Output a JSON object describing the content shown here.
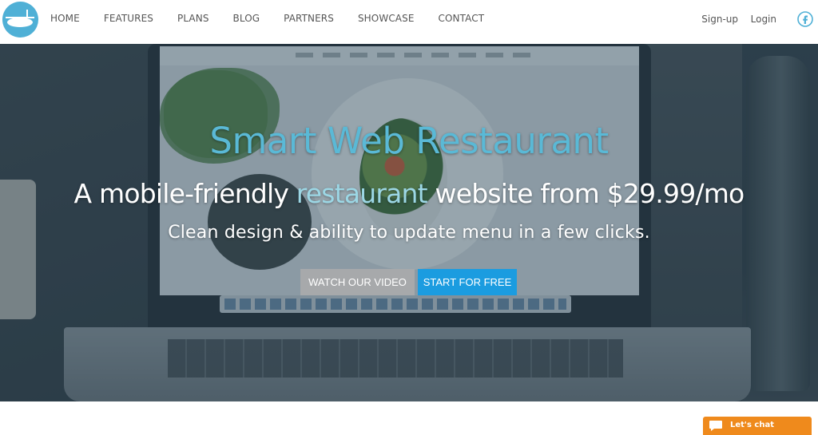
{
  "nav": {
    "links": [
      "HOME",
      "FEATURES",
      "PLANS",
      "BLOG",
      "PARTNERS",
      "SHOWCASE",
      "CONTACT"
    ],
    "signup": "Sign-up",
    "login": "Login",
    "logo_icon": "fork-spoon-logo-icon",
    "social_icon": "facebook-icon",
    "accent_color": "#4fb0d6"
  },
  "hero": {
    "title": "Smart Web Restaurant",
    "tagline_before": "A mobile-friendly ",
    "tagline_highlight": "restaurant",
    "tagline_after": " website from $29.99/mo",
    "subtitle": "Clean design & ability to update menu in a few clicks.",
    "buttons": {
      "watch_video": "WATCH OUR VIDEO",
      "start_free": "START FOR FREE"
    },
    "title_color": "#5ab9d6",
    "primary_button_color": "#1b9ce0"
  },
  "chat": {
    "label": "Let's chat",
    "icon": "chat-bubble-icon",
    "color": "#ef8a1c"
  }
}
